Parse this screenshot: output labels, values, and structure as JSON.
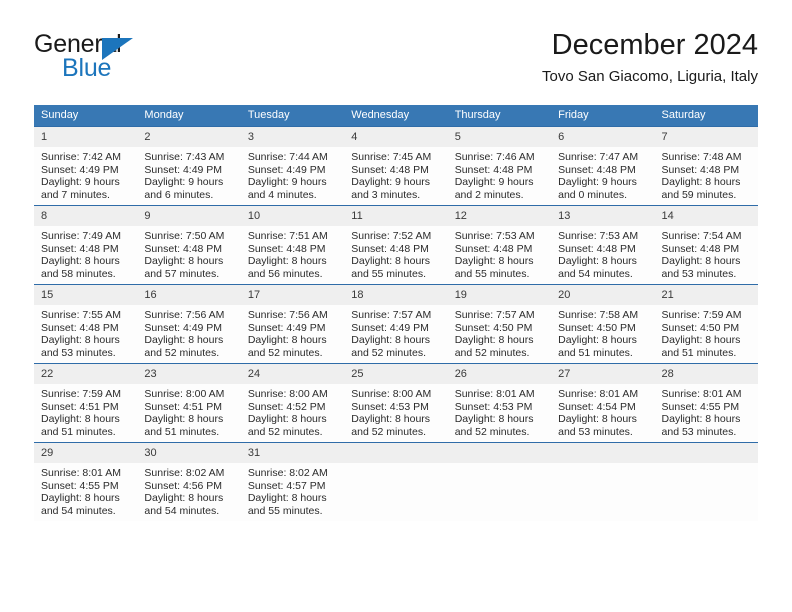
{
  "brand": {
    "name_part1": "General",
    "name_part2": "Blue",
    "triangle_color": "#1c75bc"
  },
  "header": {
    "title": "December 2024",
    "subtitle": "Tovo San Giacomo, Liguria, Italy"
  },
  "theme": {
    "header_bg": "#3878b4",
    "daynum_bg": "#efefef",
    "cell_bg": "#fdfdfd",
    "rule_color": "#2f6ca8",
    "text_color": "#2b2b2b"
  },
  "weekday_headers": [
    "Sunday",
    "Monday",
    "Tuesday",
    "Wednesday",
    "Thursday",
    "Friday",
    "Saturday"
  ],
  "weeks": [
    [
      {
        "day": "1",
        "sunrise": "Sunrise: 7:42 AM",
        "sunset": "Sunset: 4:49 PM",
        "daylight_1": "Daylight: 9 hours",
        "daylight_2": "and 7 minutes."
      },
      {
        "day": "2",
        "sunrise": "Sunrise: 7:43 AM",
        "sunset": "Sunset: 4:49 PM",
        "daylight_1": "Daylight: 9 hours",
        "daylight_2": "and 6 minutes."
      },
      {
        "day": "3",
        "sunrise": "Sunrise: 7:44 AM",
        "sunset": "Sunset: 4:49 PM",
        "daylight_1": "Daylight: 9 hours",
        "daylight_2": "and 4 minutes."
      },
      {
        "day": "4",
        "sunrise": "Sunrise: 7:45 AM",
        "sunset": "Sunset: 4:48 PM",
        "daylight_1": "Daylight: 9 hours",
        "daylight_2": "and 3 minutes."
      },
      {
        "day": "5",
        "sunrise": "Sunrise: 7:46 AM",
        "sunset": "Sunset: 4:48 PM",
        "daylight_1": "Daylight: 9 hours",
        "daylight_2": "and 2 minutes."
      },
      {
        "day": "6",
        "sunrise": "Sunrise: 7:47 AM",
        "sunset": "Sunset: 4:48 PM",
        "daylight_1": "Daylight: 9 hours",
        "daylight_2": "and 0 minutes."
      },
      {
        "day": "7",
        "sunrise": "Sunrise: 7:48 AM",
        "sunset": "Sunset: 4:48 PM",
        "daylight_1": "Daylight: 8 hours",
        "daylight_2": "and 59 minutes."
      }
    ],
    [
      {
        "day": "8",
        "sunrise": "Sunrise: 7:49 AM",
        "sunset": "Sunset: 4:48 PM",
        "daylight_1": "Daylight: 8 hours",
        "daylight_2": "and 58 minutes."
      },
      {
        "day": "9",
        "sunrise": "Sunrise: 7:50 AM",
        "sunset": "Sunset: 4:48 PM",
        "daylight_1": "Daylight: 8 hours",
        "daylight_2": "and 57 minutes."
      },
      {
        "day": "10",
        "sunrise": "Sunrise: 7:51 AM",
        "sunset": "Sunset: 4:48 PM",
        "daylight_1": "Daylight: 8 hours",
        "daylight_2": "and 56 minutes."
      },
      {
        "day": "11",
        "sunrise": "Sunrise: 7:52 AM",
        "sunset": "Sunset: 4:48 PM",
        "daylight_1": "Daylight: 8 hours",
        "daylight_2": "and 55 minutes."
      },
      {
        "day": "12",
        "sunrise": "Sunrise: 7:53 AM",
        "sunset": "Sunset: 4:48 PM",
        "daylight_1": "Daylight: 8 hours",
        "daylight_2": "and 55 minutes."
      },
      {
        "day": "13",
        "sunrise": "Sunrise: 7:53 AM",
        "sunset": "Sunset: 4:48 PM",
        "daylight_1": "Daylight: 8 hours",
        "daylight_2": "and 54 minutes."
      },
      {
        "day": "14",
        "sunrise": "Sunrise: 7:54 AM",
        "sunset": "Sunset: 4:48 PM",
        "daylight_1": "Daylight: 8 hours",
        "daylight_2": "and 53 minutes."
      }
    ],
    [
      {
        "day": "15",
        "sunrise": "Sunrise: 7:55 AM",
        "sunset": "Sunset: 4:48 PM",
        "daylight_1": "Daylight: 8 hours",
        "daylight_2": "and 53 minutes."
      },
      {
        "day": "16",
        "sunrise": "Sunrise: 7:56 AM",
        "sunset": "Sunset: 4:49 PM",
        "daylight_1": "Daylight: 8 hours",
        "daylight_2": "and 52 minutes."
      },
      {
        "day": "17",
        "sunrise": "Sunrise: 7:56 AM",
        "sunset": "Sunset: 4:49 PM",
        "daylight_1": "Daylight: 8 hours",
        "daylight_2": "and 52 minutes."
      },
      {
        "day": "18",
        "sunrise": "Sunrise: 7:57 AM",
        "sunset": "Sunset: 4:49 PM",
        "daylight_1": "Daylight: 8 hours",
        "daylight_2": "and 52 minutes."
      },
      {
        "day": "19",
        "sunrise": "Sunrise: 7:57 AM",
        "sunset": "Sunset: 4:50 PM",
        "daylight_1": "Daylight: 8 hours",
        "daylight_2": "and 52 minutes."
      },
      {
        "day": "20",
        "sunrise": "Sunrise: 7:58 AM",
        "sunset": "Sunset: 4:50 PM",
        "daylight_1": "Daylight: 8 hours",
        "daylight_2": "and 51 minutes."
      },
      {
        "day": "21",
        "sunrise": "Sunrise: 7:59 AM",
        "sunset": "Sunset: 4:50 PM",
        "daylight_1": "Daylight: 8 hours",
        "daylight_2": "and 51 minutes."
      }
    ],
    [
      {
        "day": "22",
        "sunrise": "Sunrise: 7:59 AM",
        "sunset": "Sunset: 4:51 PM",
        "daylight_1": "Daylight: 8 hours",
        "daylight_2": "and 51 minutes."
      },
      {
        "day": "23",
        "sunrise": "Sunrise: 8:00 AM",
        "sunset": "Sunset: 4:51 PM",
        "daylight_1": "Daylight: 8 hours",
        "daylight_2": "and 51 minutes."
      },
      {
        "day": "24",
        "sunrise": "Sunrise: 8:00 AM",
        "sunset": "Sunset: 4:52 PM",
        "daylight_1": "Daylight: 8 hours",
        "daylight_2": "and 52 minutes."
      },
      {
        "day": "25",
        "sunrise": "Sunrise: 8:00 AM",
        "sunset": "Sunset: 4:53 PM",
        "daylight_1": "Daylight: 8 hours",
        "daylight_2": "and 52 minutes."
      },
      {
        "day": "26",
        "sunrise": "Sunrise: 8:01 AM",
        "sunset": "Sunset: 4:53 PM",
        "daylight_1": "Daylight: 8 hours",
        "daylight_2": "and 52 minutes."
      },
      {
        "day": "27",
        "sunrise": "Sunrise: 8:01 AM",
        "sunset": "Sunset: 4:54 PM",
        "daylight_1": "Daylight: 8 hours",
        "daylight_2": "and 53 minutes."
      },
      {
        "day": "28",
        "sunrise": "Sunrise: 8:01 AM",
        "sunset": "Sunset: 4:55 PM",
        "daylight_1": "Daylight: 8 hours",
        "daylight_2": "and 53 minutes."
      }
    ],
    [
      {
        "day": "29",
        "sunrise": "Sunrise: 8:01 AM",
        "sunset": "Sunset: 4:55 PM",
        "daylight_1": "Daylight: 8 hours",
        "daylight_2": "and 54 minutes."
      },
      {
        "day": "30",
        "sunrise": "Sunrise: 8:02 AM",
        "sunset": "Sunset: 4:56 PM",
        "daylight_1": "Daylight: 8 hours",
        "daylight_2": "and 54 minutes."
      },
      {
        "day": "31",
        "sunrise": "Sunrise: 8:02 AM",
        "sunset": "Sunset: 4:57 PM",
        "daylight_1": "Daylight: 8 hours",
        "daylight_2": "and 55 minutes."
      },
      {
        "day": "",
        "sunrise": "",
        "sunset": "",
        "daylight_1": "",
        "daylight_2": ""
      },
      {
        "day": "",
        "sunrise": "",
        "sunset": "",
        "daylight_1": "",
        "daylight_2": ""
      },
      {
        "day": "",
        "sunrise": "",
        "sunset": "",
        "daylight_1": "",
        "daylight_2": ""
      },
      {
        "day": "",
        "sunrise": "",
        "sunset": "",
        "daylight_1": "",
        "daylight_2": ""
      }
    ]
  ]
}
